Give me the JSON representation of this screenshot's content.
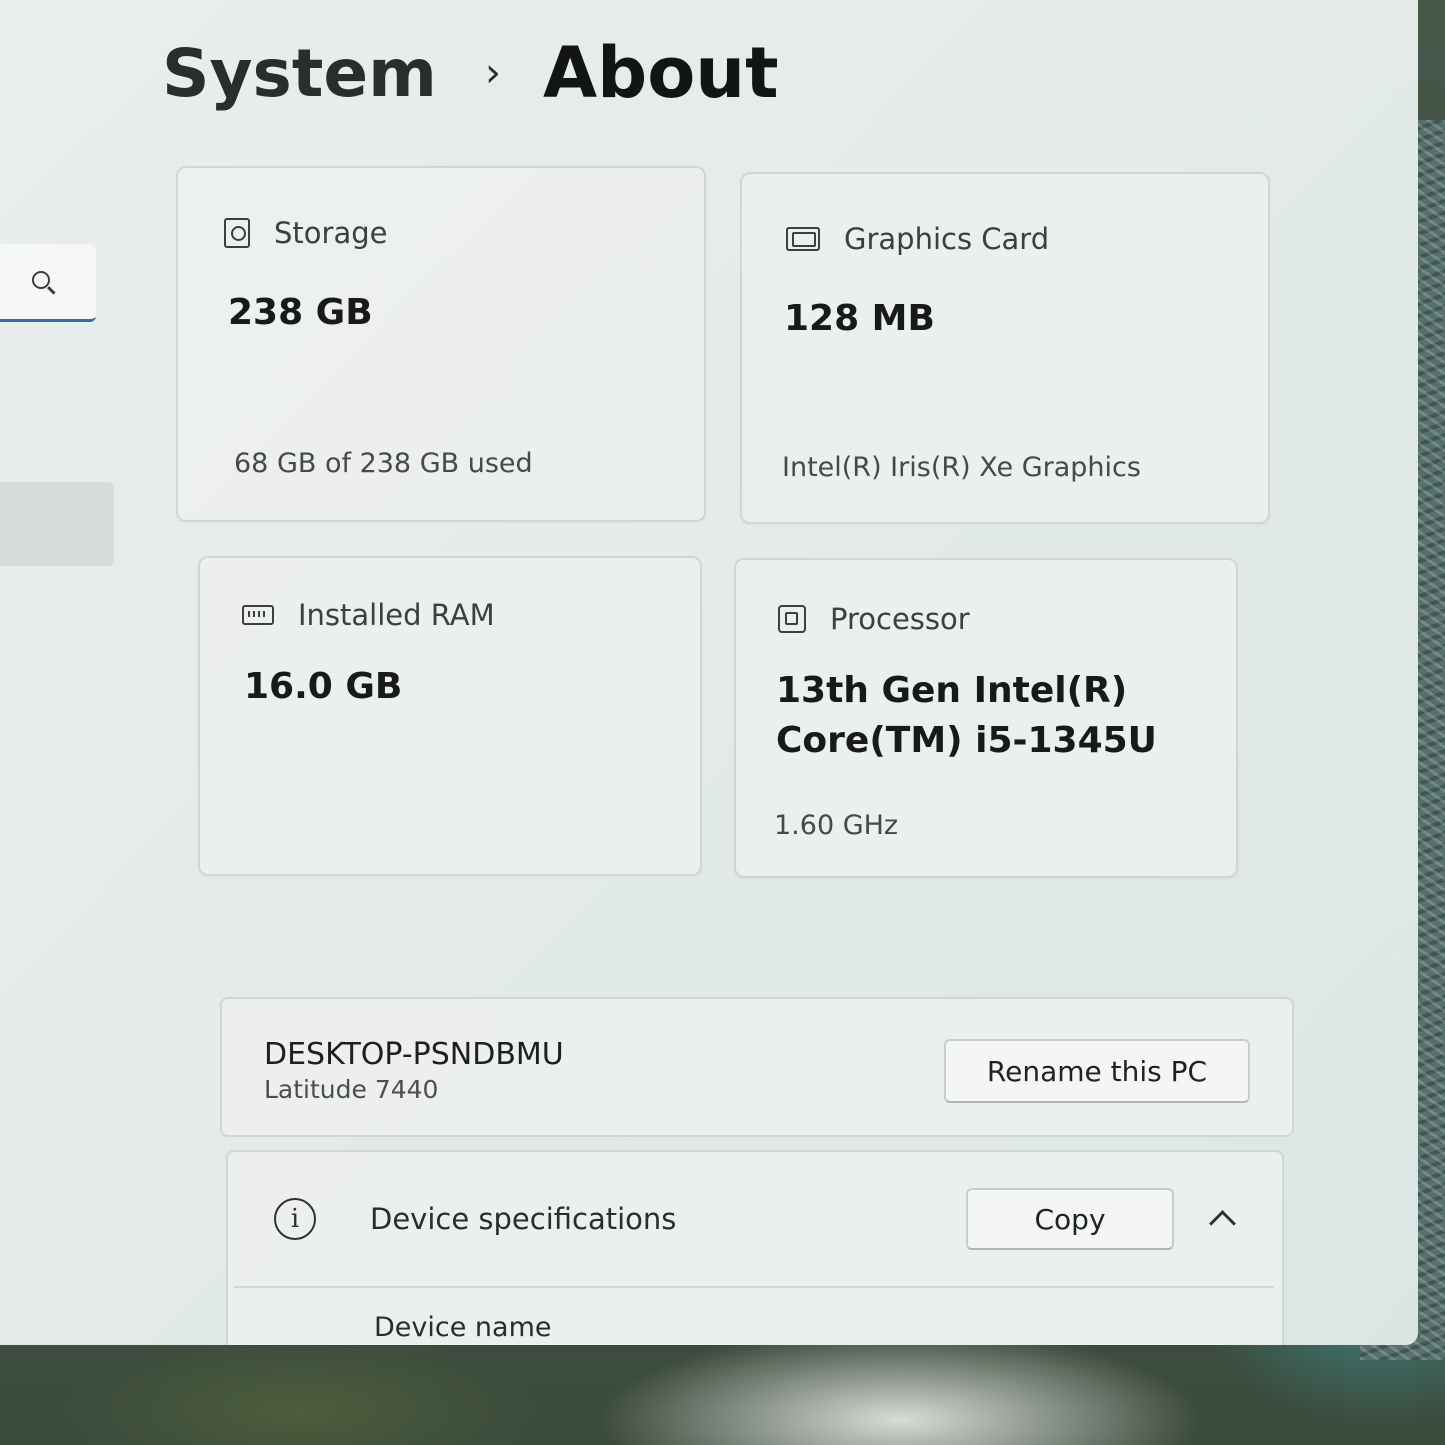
{
  "breadcrumb": {
    "parent": "System",
    "separator": "›",
    "current": "About"
  },
  "cards": {
    "storage": {
      "icon": "storage-icon",
      "title": "Storage",
      "value": "238 GB",
      "sub": "68 GB of 238 GB used"
    },
    "graphics": {
      "icon": "graphics-card-icon",
      "title": "Graphics Card",
      "value": "128 MB",
      "sub": "Intel(R) Iris(R) Xe Graphics"
    },
    "ram": {
      "icon": "ram-icon",
      "title": "Installed RAM",
      "value": "16.0 GB"
    },
    "processor": {
      "icon": "processor-icon",
      "title": "Processor",
      "value_line1": "13th Gen Intel(R)",
      "value_line2": "Core(TM) i5-1345U",
      "sub": "1.60 GHz"
    }
  },
  "device": {
    "name": "DESKTOP-PSNDBMU",
    "model": "Latitude 7440",
    "rename_label": "Rename this PC"
  },
  "specs": {
    "info_glyph": "i",
    "title": "Device specifications",
    "copy_label": "Copy",
    "first_row_label": "Device name"
  },
  "colors": {
    "accent": "#2f6fa8",
    "window_bg": "#e6ecea"
  }
}
